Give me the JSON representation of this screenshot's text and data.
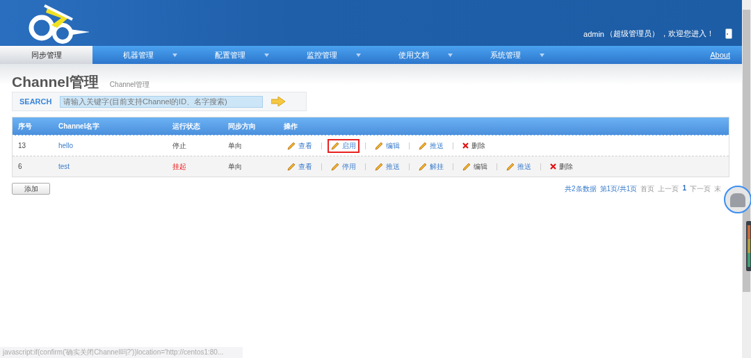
{
  "header": {
    "user": "admin",
    "role": "（超级管理员）",
    "welcome": "，欢迎您进入！"
  },
  "nav": {
    "items": [
      {
        "label": "同步管理",
        "selected": true,
        "has_menu": false
      },
      {
        "label": "机器管理",
        "selected": false,
        "has_menu": true
      },
      {
        "label": "配置管理",
        "selected": false,
        "has_menu": true
      },
      {
        "label": "监控管理",
        "selected": false,
        "has_menu": true
      },
      {
        "label": "使用文档",
        "selected": false,
        "has_menu": true
      },
      {
        "label": "系统管理",
        "selected": false,
        "has_menu": true
      }
    ],
    "about": "About"
  },
  "page": {
    "title": "Channel管理",
    "breadcrumb": "Channel管理"
  },
  "search": {
    "label": "SEARCH",
    "placeholder": "请输入关键字(目前支持Channel的ID、名字搜索)"
  },
  "table": {
    "columns": [
      "序号",
      "Channel名字",
      "运行状态",
      "同步方向",
      "操作"
    ],
    "rows": [
      {
        "id": "13",
        "name": "hello",
        "status": "停止",
        "status_alert": false,
        "direction": "单向",
        "actions": [
          {
            "label": "查看",
            "kind": "pencil",
            "link": true,
            "highlighted": false
          },
          {
            "label": "启用",
            "kind": "pencil",
            "link": true,
            "highlighted": true
          },
          {
            "label": "编辑",
            "kind": "pencil",
            "link": true,
            "highlighted": false
          },
          {
            "label": "推送",
            "kind": "pencil",
            "link": true,
            "highlighted": false
          },
          {
            "label": "删除",
            "kind": "cross",
            "link": false,
            "highlighted": false
          }
        ]
      },
      {
        "id": "6",
        "name": "test",
        "status": "挂起",
        "status_alert": true,
        "direction": "单向",
        "actions": [
          {
            "label": "查看",
            "kind": "pencil",
            "link": true,
            "highlighted": false
          },
          {
            "label": "停用",
            "kind": "pencil",
            "link": true,
            "highlighted": false
          },
          {
            "label": "推送",
            "kind": "pencil",
            "link": true,
            "highlighted": false
          },
          {
            "label": "解挂",
            "kind": "pencil",
            "link": true,
            "highlighted": false
          },
          {
            "label": "编辑",
            "kind": "pencil",
            "link": false,
            "highlighted": false
          },
          {
            "label": "推送",
            "kind": "pencil",
            "link": true,
            "highlighted": false
          },
          {
            "label": "删除",
            "kind": "cross",
            "link": false,
            "highlighted": false
          }
        ]
      }
    ]
  },
  "add_button": "添加",
  "pagination": {
    "total": "共2条数据",
    "page": "第1页/共1页",
    "first": "首页",
    "prev": "上一页",
    "current": "1",
    "next": "下一页",
    "last": "末"
  },
  "status_bar": "javascript:if(confirm('确实关闭Channel吗?'))location='http://centos1:80..."
}
